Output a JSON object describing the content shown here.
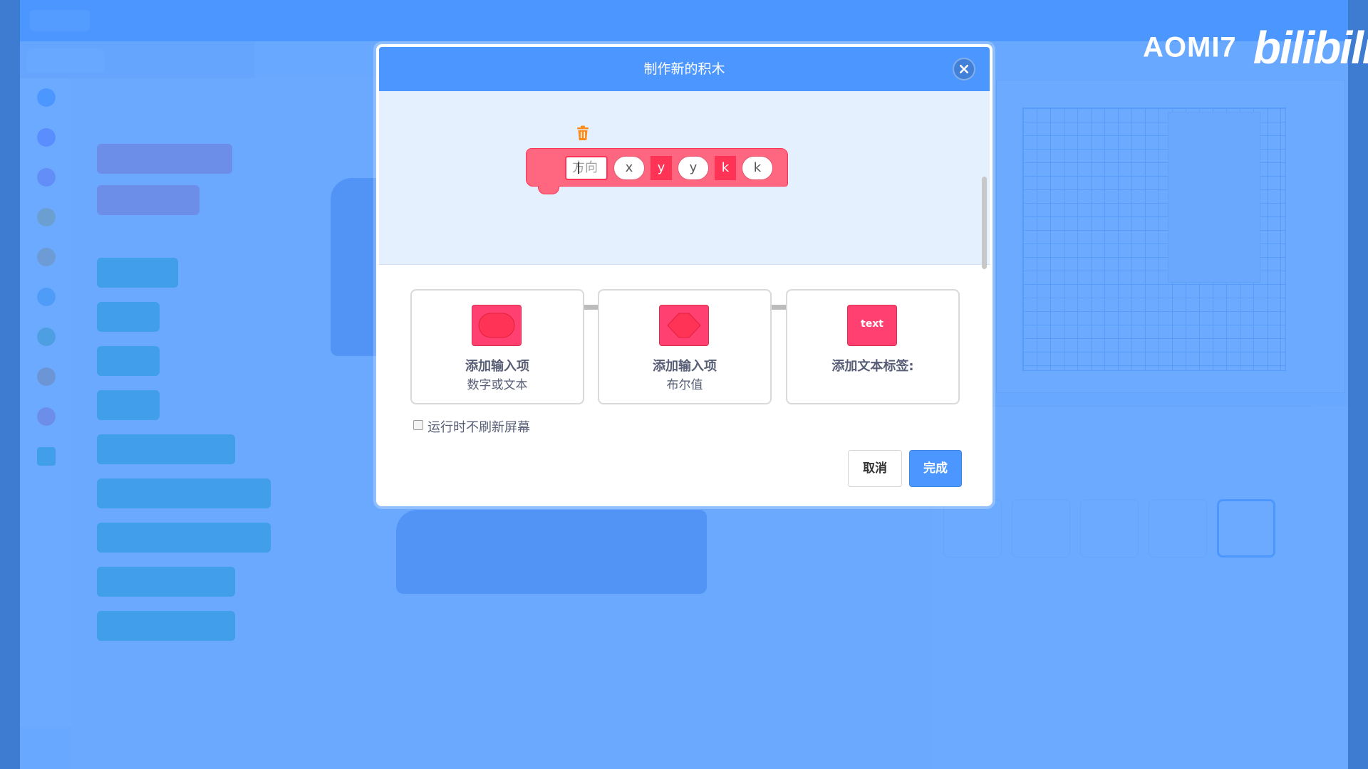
{
  "watermark": {
    "user": "AOMI7",
    "brand": "bilibili"
  },
  "modal": {
    "title": "制作新的积木",
    "close_icon": "close-icon",
    "block": {
      "text_field_placeholder": "方向",
      "args": [
        {
          "kind": "pill",
          "text": "x"
        },
        {
          "kind": "label",
          "text": "y"
        },
        {
          "kind": "pill",
          "text": "y"
        },
        {
          "kind": "label",
          "text": "k"
        },
        {
          "kind": "pill",
          "text": "k"
        }
      ],
      "colors": {
        "fill": "#ff6680",
        "border": "#ff3355"
      },
      "delete_icon": "trash-icon"
    },
    "options": [
      {
        "title": "添加输入项",
        "subtitle": "数字或文本",
        "shape": "round"
      },
      {
        "title": "添加输入项",
        "subtitle": "布尔值",
        "shape": "diamond"
      },
      {
        "title": "添加文本标签:",
        "subtitle": "",
        "shape": "text",
        "swatch_text": "text"
      }
    ],
    "checkbox": {
      "label": "运行时不刷新屏幕",
      "checked": false
    },
    "buttons": {
      "cancel": "取消",
      "done": "完成"
    }
  },
  "colors": {
    "accent": "#4c97ff",
    "overlay": "rgba(76,151,255,0.82)",
    "block": "#ff6680"
  }
}
